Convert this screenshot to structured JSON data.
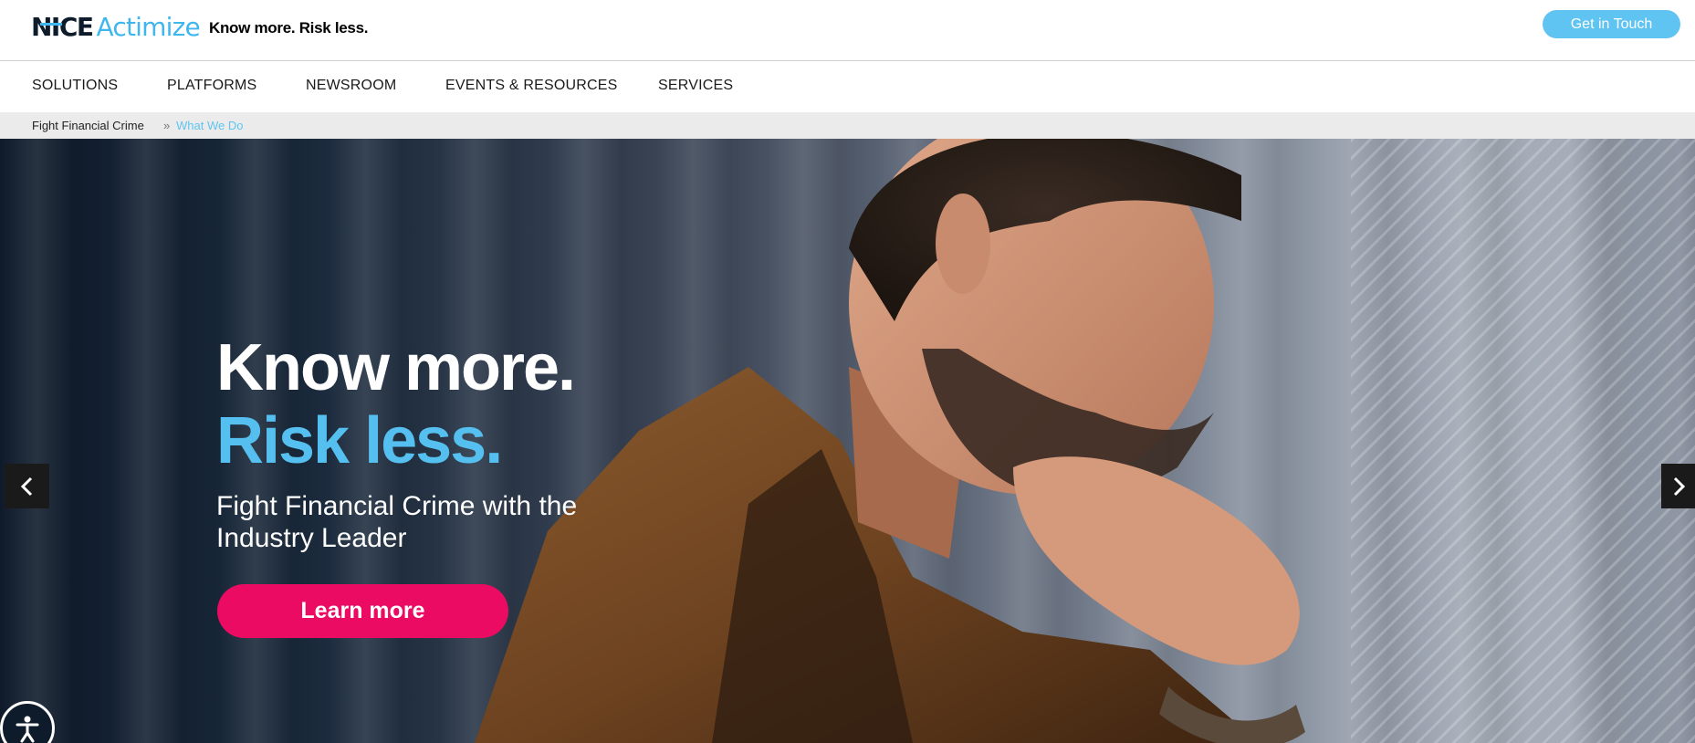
{
  "header": {
    "logo_nice": "NICE",
    "logo_actimize": "Actimize",
    "tagline": "Know more. Risk less.",
    "cta_label": "Get in Touch"
  },
  "nav": {
    "items": [
      {
        "label": "SOLUTIONS"
      },
      {
        "label": "PLATFORMS"
      },
      {
        "label": "NEWSROOM"
      },
      {
        "label": "EVENTS & RESOURCES"
      },
      {
        "label": "SERVICES"
      }
    ]
  },
  "breadcrumb": {
    "items": [
      {
        "label": "Fight Financial Crime"
      },
      {
        "label": "What We Do"
      }
    ],
    "separator": "»"
  },
  "hero": {
    "headline_1": "Know more.",
    "headline_2": "Risk less.",
    "subline_1": "Fight Financial Crime with the",
    "subline_2": "Industry Leader",
    "button_label": "Learn more"
  },
  "icons": {
    "prev": "chevron-left-icon",
    "next": "chevron-right-icon",
    "accessibility": "accessibility-icon"
  },
  "colors": {
    "brand_blue": "#3fb6ee",
    "cta_pink": "#ec0b63",
    "dark": "#0d1b2a"
  }
}
